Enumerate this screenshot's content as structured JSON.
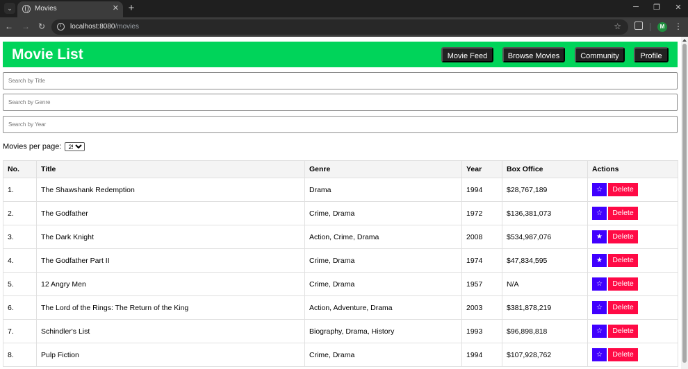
{
  "browser": {
    "tab_title": "Movies",
    "url_host": "localhost:8080",
    "url_path": "/movies",
    "profile_initial": "M"
  },
  "header": {
    "title": "Movie List",
    "nav": [
      "Movie Feed",
      "Browse Movies",
      "Community",
      "Profile"
    ]
  },
  "search": {
    "title_placeholder": "Search by Title",
    "genre_placeholder": "Search by Genre",
    "year_placeholder": "Search by Year"
  },
  "pagination": {
    "label": "Movies per page:",
    "selected": "25"
  },
  "table": {
    "headers": [
      "No.",
      "Title",
      "Genre",
      "Year",
      "Box Office",
      "Actions"
    ],
    "delete_label": "Delete",
    "rows": [
      {
        "no": "1.",
        "title": "The Shawshank Redemption",
        "genre": "Drama",
        "year": "1994",
        "box": "$28,767,189",
        "star": "☆"
      },
      {
        "no": "2.",
        "title": "The Godfather",
        "genre": "Crime, Drama",
        "year": "1972",
        "box": "$136,381,073",
        "star": "☆"
      },
      {
        "no": "3.",
        "title": "The Dark Knight",
        "genre": "Action, Crime, Drama",
        "year": "2008",
        "box": "$534,987,076",
        "star": "★"
      },
      {
        "no": "4.",
        "title": "The Godfather Part II",
        "genre": "Crime, Drama",
        "year": "1974",
        "box": "$47,834,595",
        "star": "★"
      },
      {
        "no": "5.",
        "title": "12 Angry Men",
        "genre": "Crime, Drama",
        "year": "1957",
        "box": "N/A",
        "star": "☆"
      },
      {
        "no": "6.",
        "title": "The Lord of the Rings: The Return of the King",
        "genre": "Action, Adventure, Drama",
        "year": "2003",
        "box": "$381,878,219",
        "star": "☆"
      },
      {
        "no": "7.",
        "title": "Schindler's List",
        "genre": "Biography, Drama, History",
        "year": "1993",
        "box": "$96,898,818",
        "star": "☆"
      },
      {
        "no": "8.",
        "title": "Pulp Fiction",
        "genre": "Crime, Drama",
        "year": "1994",
        "box": "$107,928,762",
        "star": "☆"
      }
    ]
  },
  "colors": {
    "header_bg": "#00d45a",
    "nav_btn_bg": "#222222",
    "star_btn_bg": "#4000ff",
    "delete_btn_bg": "#ff0a45"
  }
}
